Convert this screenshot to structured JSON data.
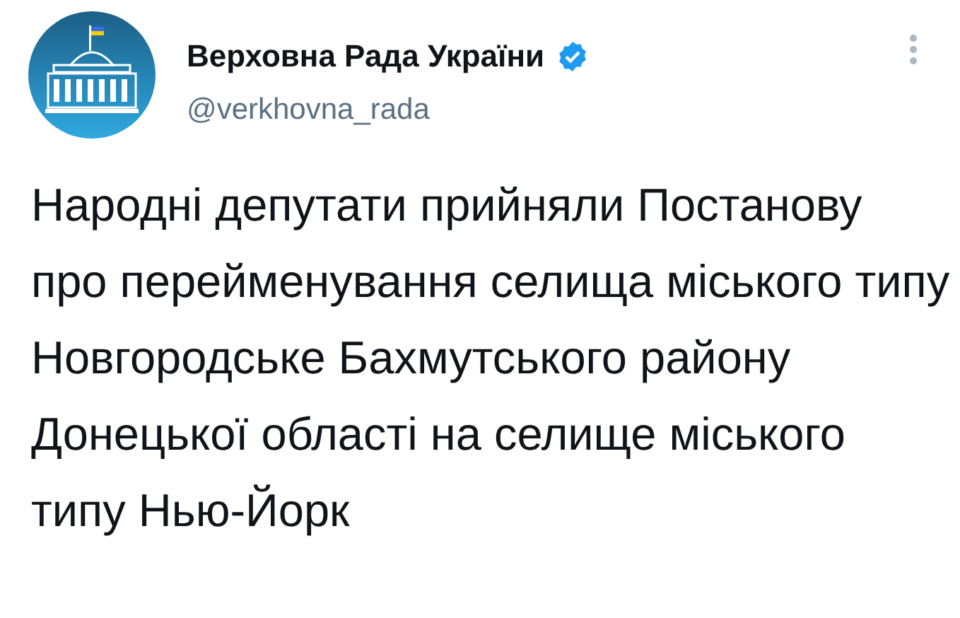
{
  "author": {
    "name": "Верховна Рада України",
    "verified": true,
    "handle": "@verkhovna_rada"
  },
  "tweet": {
    "text": "Народні депутати прийняли Постанову про перейменування селища міського типу Новгородське Бахмутського району Донецької області на селище міського типу Нью-Йорк"
  }
}
